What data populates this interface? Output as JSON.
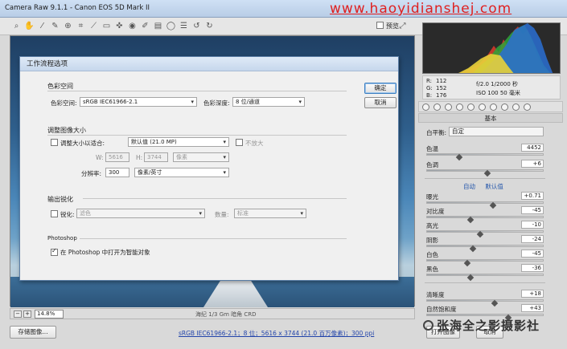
{
  "window": {
    "title": "Camera Raw 9.1.1 - Canon EOS 5D Mark II",
    "watermark_top": "www.haoyidianshej.com",
    "preview_label": "预览"
  },
  "rgb_readout": {
    "r_label": "R:",
    "r_val": "112",
    "g_label": "G:",
    "g_val": "152",
    "b_label": "B:",
    "b_val": "176",
    "aperture_shutter": "f/2.0   1/2000 秒",
    "iso_focal": "ISO 100   50 毫米"
  },
  "panel": {
    "header": "基本",
    "wb_label": "白平衡:",
    "wb_value": "自定",
    "auto_label": "自动",
    "default_label": "默认值",
    "sliders": [
      {
        "label": "色温",
        "value": "4452",
        "pos": 0.28
      },
      {
        "label": "色调",
        "value": "+6",
        "pos": 0.52
      },
      {
        "label": "曝光",
        "value": "+0.71",
        "pos": 0.57
      },
      {
        "label": "对比度",
        "value": "-45",
        "pos": 0.38
      },
      {
        "label": "高光",
        "value": "-10",
        "pos": 0.46
      },
      {
        "label": "阴影",
        "value": "-24",
        "pos": 0.4
      },
      {
        "label": "白色",
        "value": "-45",
        "pos": 0.35
      },
      {
        "label": "黑色",
        "value": "-36",
        "pos": 0.38
      },
      {
        "label": "清晰度",
        "value": "+18",
        "pos": 0.58
      },
      {
        "label": "自然饱和度",
        "value": "+43",
        "pos": 0.7
      }
    ]
  },
  "bottom": {
    "zoom_value": "14.8%",
    "caption": "海纪 1/3 Gm 暗角 CRD",
    "save_label": "存储图像...",
    "workflow_link": "sRGB IEC61966-2.1；8 位；5616 x 3744 (21.0 百万像素)；300 ppi",
    "open_label": "打开图像",
    "done_label": "取消",
    "watermark_bottom": "张海全之影摄影社"
  },
  "dialog": {
    "title": "工作流程选项",
    "ok_label": "确定",
    "cancel_label": "取消",
    "color_space": {
      "group": "色彩空间",
      "space_label": "色彩空间:",
      "space_value": "sRGB IEC61966-2.1",
      "depth_label": "色彩深度:",
      "depth_value": "8 位/通道"
    },
    "resize": {
      "group": "调整图像大小",
      "fit_label": "调整大小以适合:",
      "fit_value": "默认值 (21.0 MP)",
      "enlarge_label": "不放大",
      "w_label": "W:",
      "w_value": "5616",
      "h_label": "H:",
      "h_value": "3744",
      "unit_value": "像素",
      "res_label": "分辨率:",
      "res_value": "300",
      "res_unit_value": "像素/英寸"
    },
    "sharpen": {
      "group": "输出锐化",
      "sharpen_label": "锐化:",
      "sharpen_for_value": "滤色",
      "amount_label": "数量:",
      "amount_value": "标准"
    },
    "photoshop": {
      "group": "Photoshop",
      "smart_label": "在 Photoshop 中打开为智能对象"
    }
  }
}
